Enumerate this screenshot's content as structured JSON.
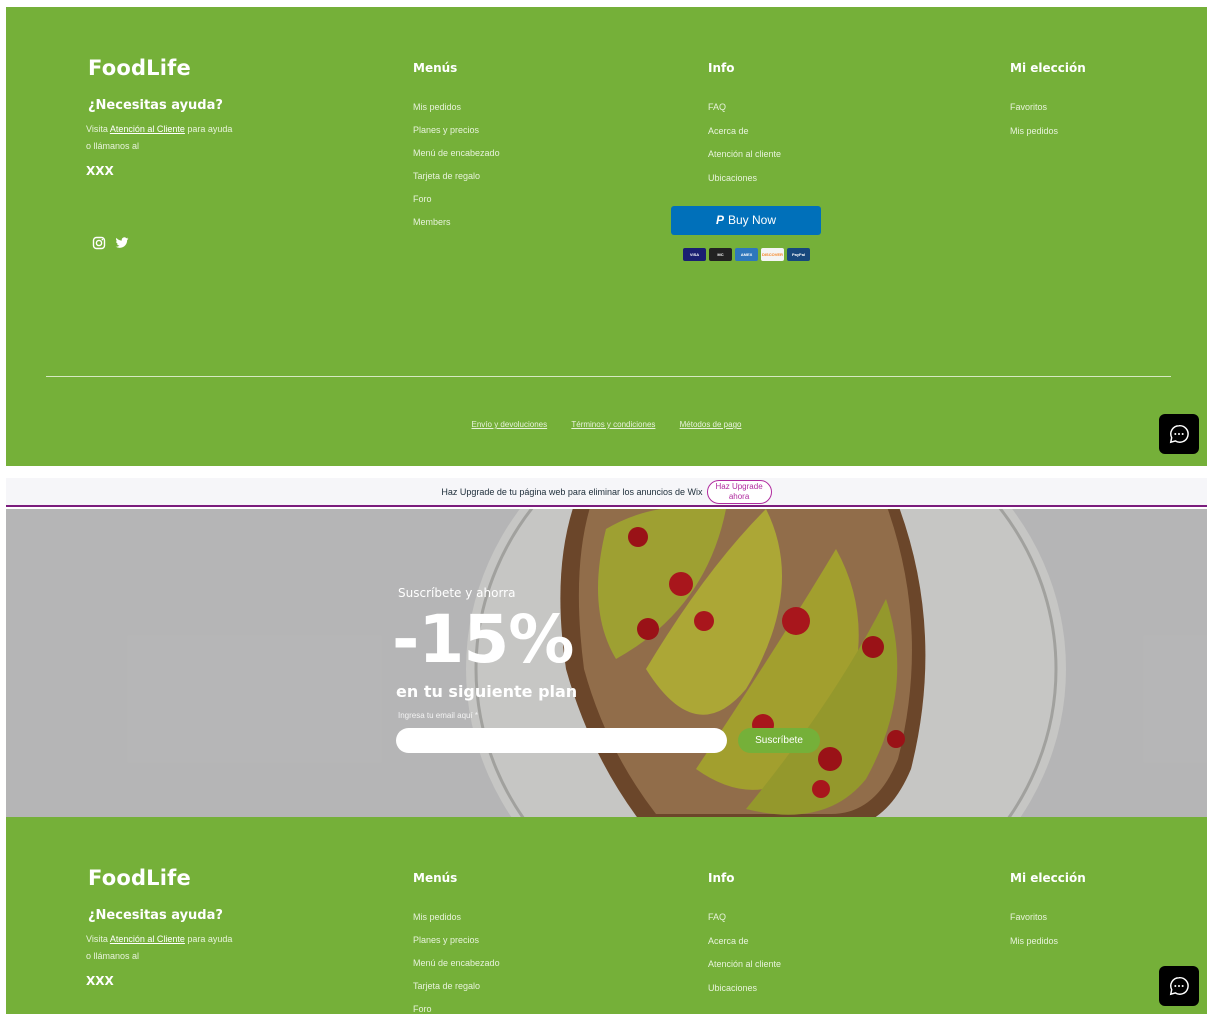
{
  "footer": {
    "brand": "FoodLife",
    "help_title": "¿Necesitas ayuda?",
    "help_line1_pre": "Visita ",
    "help_link": "Atención al Cliente",
    "help_line1_post": " para ayuda",
    "help_line2": "o llámanos al",
    "phone": "XXX",
    "menus": {
      "title": "Menús",
      "items": [
        "Mis pedidos",
        "Planes y precios",
        "Menú de encabezado",
        "Tarjeta de regalo",
        "Foro",
        "Members"
      ]
    },
    "info": {
      "title": "Info",
      "items": [
        "FAQ",
        "Acerca de",
        "Atención al cliente",
        "Ubicaciones"
      ]
    },
    "choice": {
      "title": "Mi elección",
      "items": [
        "Favoritos",
        "Mis pedidos"
      ]
    },
    "buy_now": {
      "logo": "P",
      "label": "Buy Now"
    },
    "cards": [
      "VISA",
      "MC",
      "AMEX",
      "DISCOVER",
      "PayPal"
    ],
    "bottom_links": [
      "Envío y devoluciones",
      "Términos y condiciones",
      "Métodos de pago"
    ],
    "icons": [
      "instagram-icon",
      "twitter-icon",
      "chat-icon"
    ]
  },
  "wixbar": {
    "text": "Haz Upgrade de tu página web para eliminar los anuncios de Wix",
    "button_line1": "Haz Upgrade",
    "button_line2": "ahora"
  },
  "hero": {
    "subtitle": "Suscríbete y ahorra",
    "discount": "-15%",
    "plan_text": "en tu siguiente plan",
    "email_label": "Ingresa tu email aquí *",
    "email_value": "",
    "button": "Suscríbete"
  },
  "colors": {
    "green": "#75b039",
    "paypal": "#0070ba",
    "wix_accent": "#b02b9f"
  }
}
